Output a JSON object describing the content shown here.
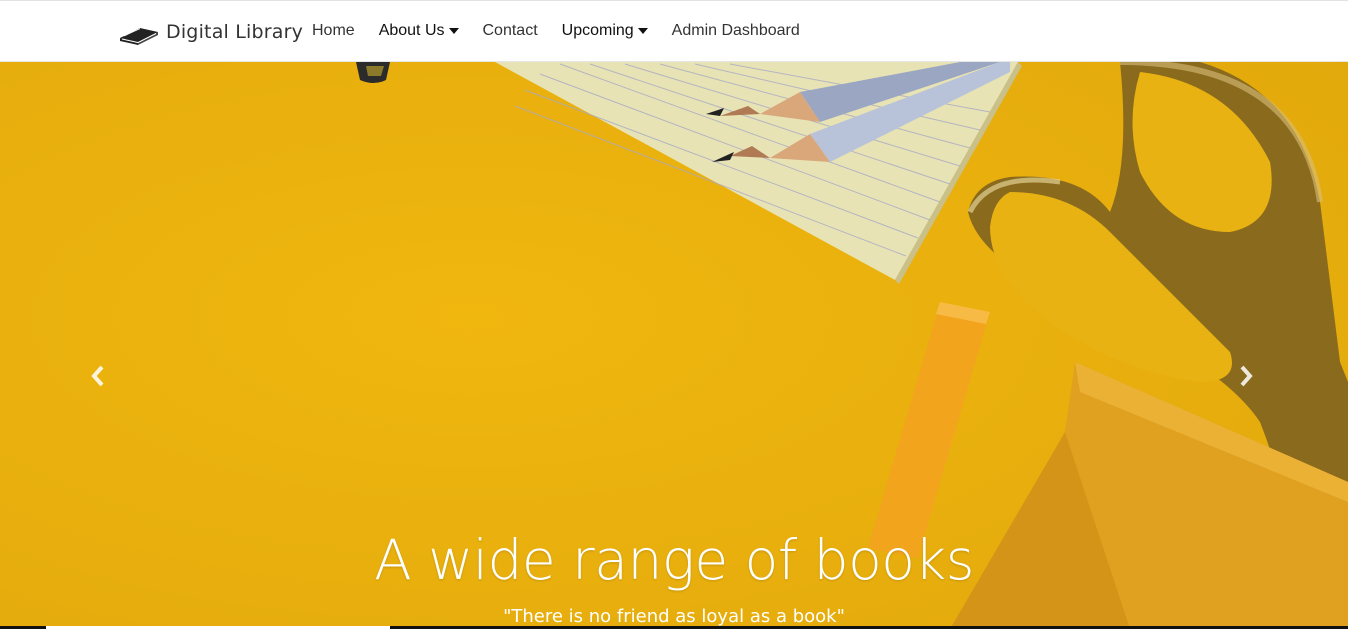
{
  "brand": {
    "name": "Digital Library",
    "icon": "book-icon"
  },
  "nav": {
    "home": "Home",
    "about": "About Us",
    "contact": "Contact",
    "upcoming": "Upcoming",
    "admin": "Admin Dashboard"
  },
  "carousel": {
    "title": "A wide range of books",
    "subtitle": "\"There is no friend as loyal as a book\"",
    "prev_icon": "chevron-left-icon",
    "next_icon": "chevron-right-icon",
    "background_color": "#e9b110",
    "active_slide": 2,
    "slides_count": 3
  }
}
